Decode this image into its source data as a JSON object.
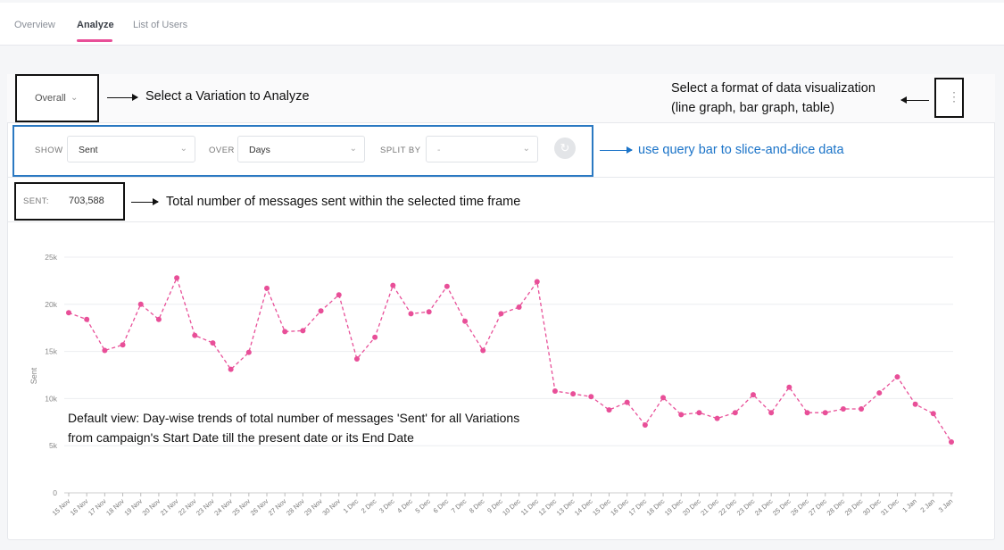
{
  "tabs": [
    {
      "label": "Overview"
    },
    {
      "label": "Analyze"
    },
    {
      "label": "List of Users"
    }
  ],
  "variation": {
    "label": "Overall",
    "icon": "chevron-down-icon"
  },
  "menu_icon": "kebab-menu-icon",
  "query_bar": {
    "show_label": "SHOW",
    "show_value": "Sent",
    "over_label": "OVER",
    "over_value": "Days",
    "split_label": "SPLIT BY",
    "split_value": "-",
    "refresh_icon": "refresh-icon"
  },
  "summary": {
    "label": "SENT:",
    "value": "703,588"
  },
  "annotations": {
    "variation": "Select a Variation to Analyze",
    "format_line1": "Select a format of data visualization",
    "format_line2": "(line graph, bar graph, table)",
    "query": "use query bar to slice-and-dice data",
    "total": "Total number of messages sent within the selected time frame",
    "default_line1": "Default view: Day-wise trends of total number of messages 'Sent' for all Variations",
    "default_line2": "from campaign's Start Date till the present date or its End Date"
  },
  "colors": {
    "accent": "#e84f98",
    "annotation_blue": "#1a73c8"
  },
  "chart_data": {
    "type": "line",
    "ylabel": "Sent",
    "xlabel": "",
    "ylim": [
      0,
      25000
    ],
    "yticks": [
      "0",
      "5k",
      "10k",
      "15k",
      "20k",
      "25k"
    ],
    "grid": true,
    "categories": [
      "15 Nov",
      "16 Nov",
      "17 Nov",
      "18 Nov",
      "19 Nov",
      "20 Nov",
      "21 Nov",
      "22 Nov",
      "23 Nov",
      "24 Nov",
      "25 Nov",
      "26 Nov",
      "27 Nov",
      "28 Nov",
      "29 Nov",
      "30 Nov",
      "1 Dec",
      "2 Dec",
      "3 Dec",
      "4 Dec",
      "5 Dec",
      "6 Dec",
      "7 Dec",
      "8 Dec",
      "9 Dec",
      "10 Dec",
      "11 Dec",
      "12 Dec",
      "13 Dec",
      "14 Dec",
      "15 Dec",
      "16 Dec",
      "17 Dec",
      "18 Dec",
      "19 Dec",
      "20 Dec",
      "21 Dec",
      "22 Dec",
      "23 Dec",
      "24 Dec",
      "25 Dec",
      "26 Dec",
      "27 Dec",
      "28 Dec",
      "29 Dec",
      "30 Dec",
      "31 Dec",
      "1 Jan",
      "2 Jan",
      "3 Jan"
    ],
    "series": [
      {
        "values": [
          19100,
          18400,
          15100,
          15700,
          20000,
          18400,
          22800,
          16700,
          15900,
          13100,
          14900,
          21700,
          17100,
          17200,
          19300,
          21000,
          14200,
          16500,
          22000,
          19000,
          19200,
          21900,
          18200,
          15100,
          19000,
          19700,
          22400,
          10800,
          10500,
          10200,
          8800,
          9600,
          7200,
          10100,
          8300,
          8500,
          7900,
          8500,
          10400,
          8500,
          11200,
          8500,
          8500,
          8900,
          8900,
          10600,
          12300,
          9400,
          8400,
          5400
        ]
      }
    ]
  }
}
